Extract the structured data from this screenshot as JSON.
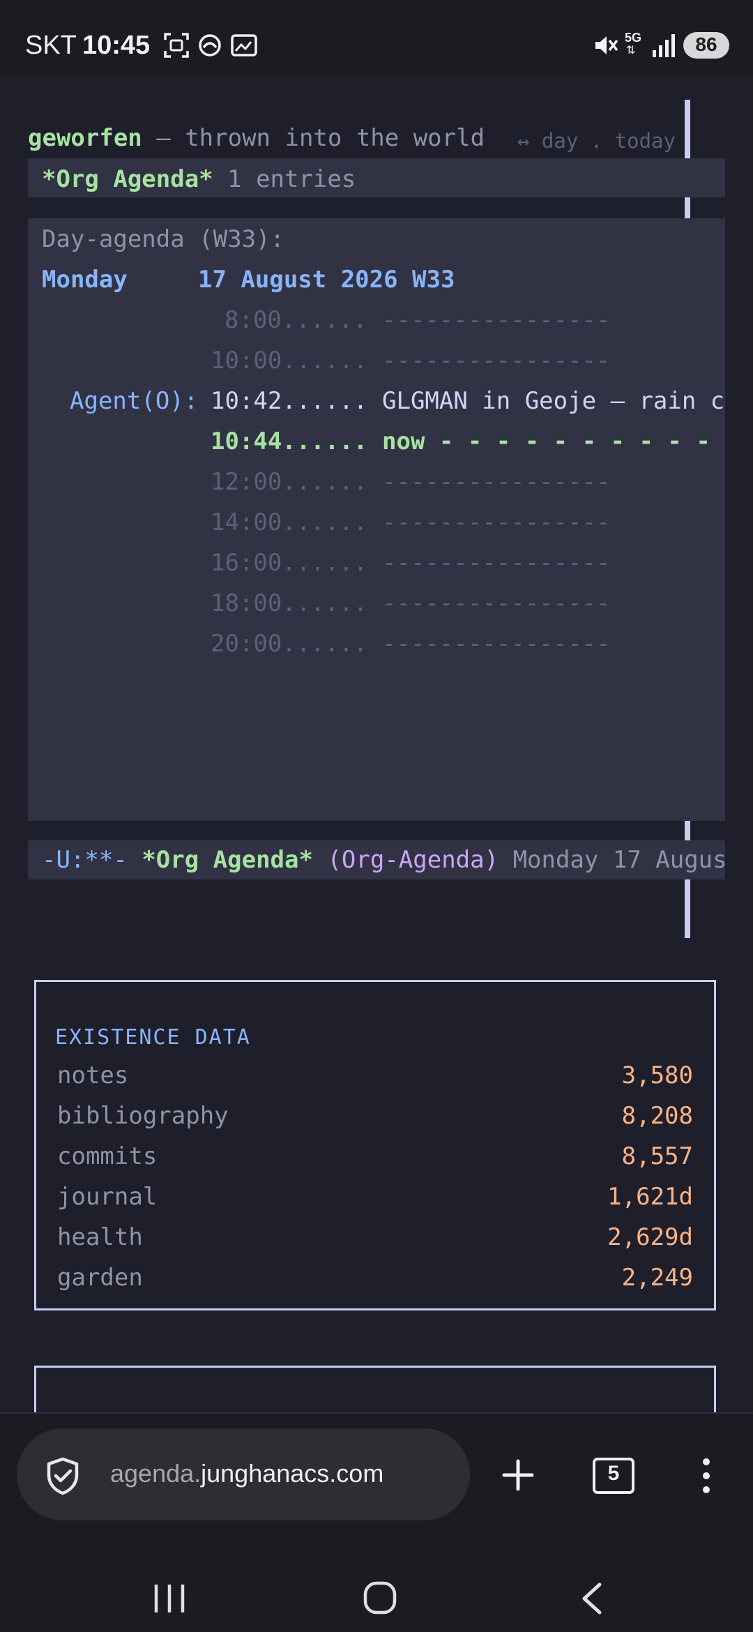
{
  "status_bar": {
    "carrier": "SKT",
    "time": "10:45",
    "network": "5G",
    "battery": "86"
  },
  "header": {
    "site_name": "geworfen",
    "tagline": "— thrown into the world",
    "nav": "↔ day . today"
  },
  "agenda_buffer": {
    "buffer_name": "*Org Agenda*",
    "entries": "1 entries",
    "view_title": "Day-agenda (W33):",
    "day_name": "Monday",
    "date": "17 August 2026 W33",
    "rows": [
      {
        "time": "8:00......",
        "text": "----------------",
        "type": "slot"
      },
      {
        "time": "10:00......",
        "text": "----------------",
        "type": "slot"
      },
      {
        "category": "Agent(O):",
        "time": "10:42......",
        "text": "GLGMAN in Geoje — rain co",
        "type": "entry"
      },
      {
        "time": "10:44......",
        "text": "now - - - - - - - - - - - -",
        "type": "now"
      },
      {
        "time": "12:00......",
        "text": "----------------",
        "type": "slot"
      },
      {
        "time": "14:00......",
        "text": "----------------",
        "type": "slot"
      },
      {
        "time": "16:00......",
        "text": "----------------",
        "type": "slot"
      },
      {
        "time": "18:00......",
        "text": "----------------",
        "type": "slot"
      },
      {
        "time": "20:00......",
        "text": "----------------",
        "type": "slot"
      }
    ],
    "modeline": {
      "state": "-U:**-",
      "buffer": "*Org Agenda*",
      "mode": "(Org-Agenda)",
      "info": "Monday 17 Augus"
    }
  },
  "existence_data": {
    "label": "EXISTENCE DATA",
    "items": [
      {
        "name": "notes",
        "value": "3,580"
      },
      {
        "name": "bibliography",
        "value": "8,208"
      },
      {
        "name": "commits",
        "value": "8,557"
      },
      {
        "name": "journal",
        "value": "1,621d"
      },
      {
        "name": "health",
        "value": "2,629d"
      },
      {
        "name": "garden",
        "value": "2,249"
      }
    ]
  },
  "browser": {
    "url_prefix": "agenda.",
    "url_domain": "junghanacs.com",
    "tab_count": "5"
  },
  "colors": {
    "background": "#1f1f2b",
    "green": "#a6e3a1",
    "blue": "#89b4fa",
    "orange": "#fab387",
    "purple": "#cba6f7"
  }
}
